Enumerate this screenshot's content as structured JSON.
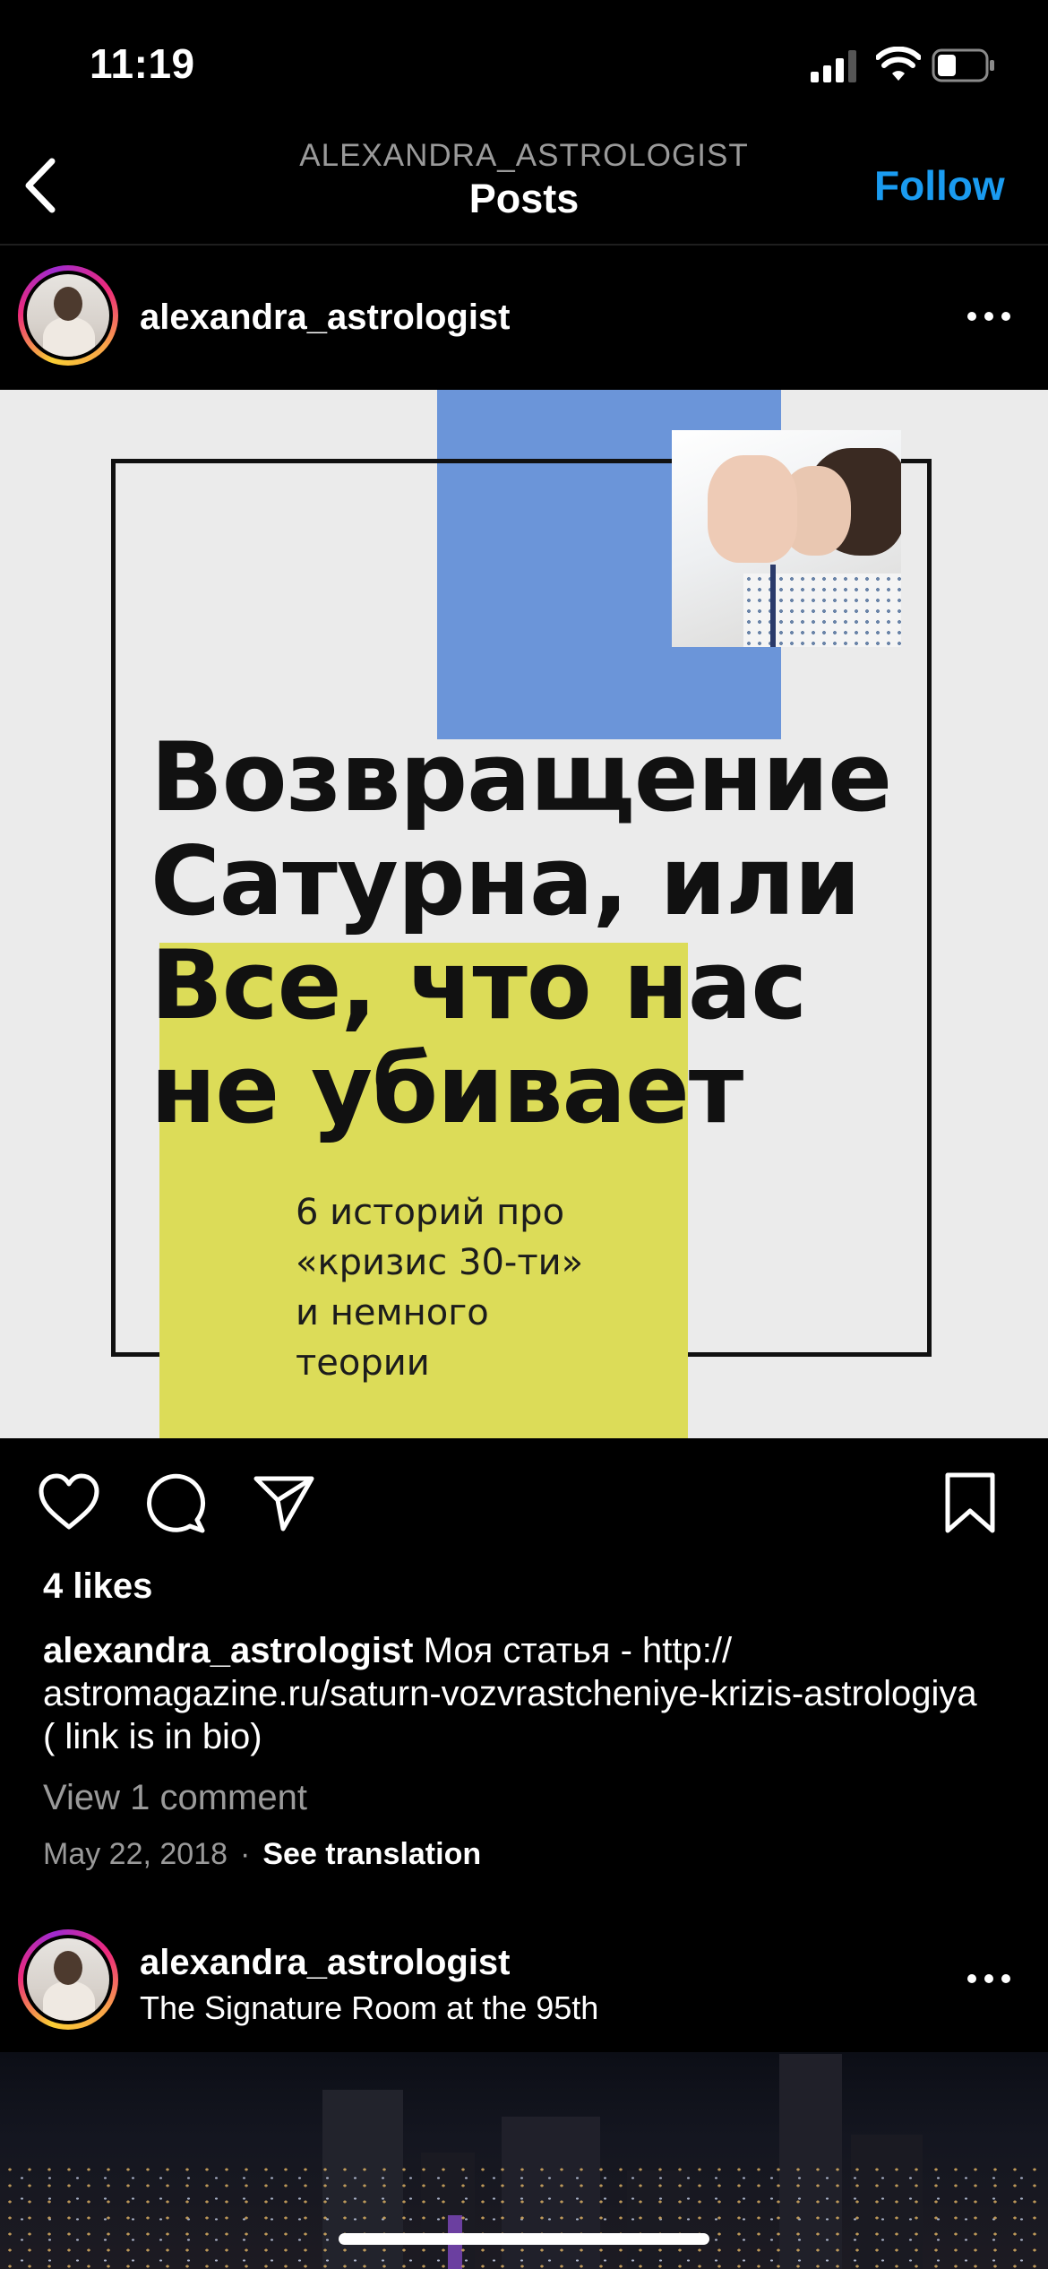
{
  "status_bar": {
    "time": "11:19"
  },
  "nav": {
    "username": "ALEXANDRA_ASTROLOGIST",
    "title": "Posts",
    "follow_label": "Follow"
  },
  "post1": {
    "username": "alexandra_astrologist",
    "image": {
      "headline_lines": [
        "Возвращение",
        "Сатурна, или",
        "Все, что нас",
        "не убивает"
      ],
      "subtitle_lines": [
        "6 историй про",
        "«кризис 30-ти»",
        "и немного",
        "теории"
      ],
      "colors": {
        "blue": "#6b95d9",
        "yellow": "#dcdc58",
        "background": "#ebebeb"
      }
    },
    "likes": "4 likes",
    "caption_user": "alexandra_astrologist",
    "caption_text": " Моя статья - http:// astromagazine.ru/saturn-vozvrastcheniye-krizis-astrologiya ( link is in bio)",
    "view_comments": "View 1 comment",
    "date": "May 22, 2018",
    "separator": "·",
    "see_translation": "See translation"
  },
  "post2": {
    "username": "alexandra_astrologist",
    "location": "The Signature Room at the 95th"
  },
  "icons": [
    "back-chevron-icon",
    "heart-icon",
    "comment-icon",
    "share-icon",
    "bookmark-icon",
    "more-icon",
    "signal-icon",
    "wifi-icon",
    "battery-icon"
  ],
  "colors": {
    "accent": "#1a9bf0",
    "background": "#000000",
    "muted_text": "#9a9a9a"
  }
}
